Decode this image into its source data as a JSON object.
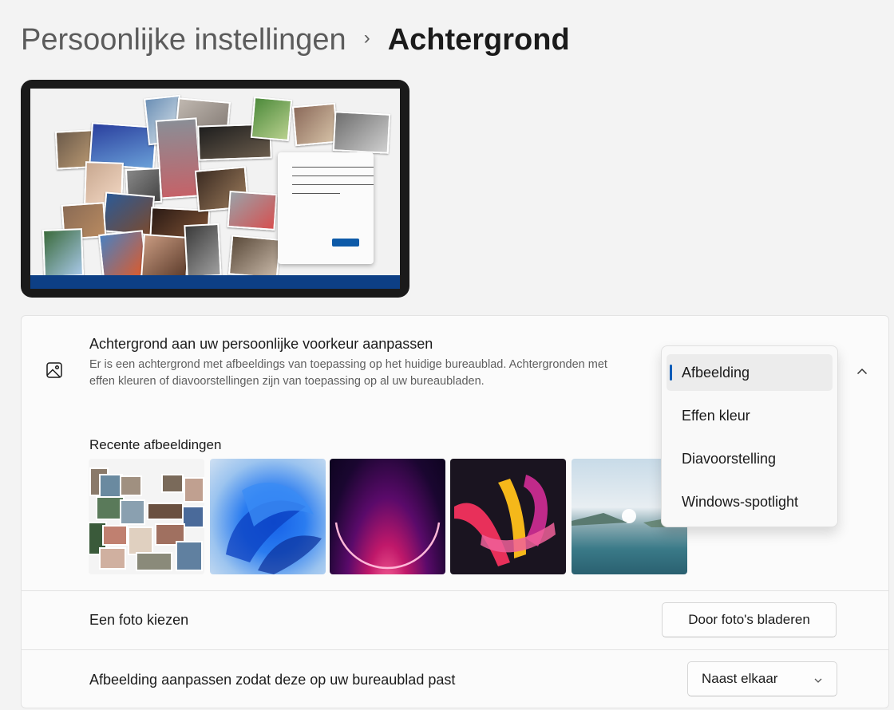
{
  "breadcrumb": {
    "parent": "Persoonlijke instellingen",
    "separator": "›",
    "current": "Achtergrond"
  },
  "background_setting": {
    "icon": "picture-icon",
    "title": "Achtergrond aan uw persoonlijke voorkeur aanpassen",
    "description": "Er is een achtergrond met afbeeldings van toepassing op het huidige bureaublad. Achtergronden met effen kleuren of diavoorstellingen zijn van toepassing op al uw bureaubladen.",
    "selected": "Afbeelding",
    "options": [
      "Afbeelding",
      "Effen kleur",
      "Diavoorstelling",
      "Windows-spotlight"
    ]
  },
  "recent": {
    "title": "Recente afbeeldingen",
    "images": [
      "photo-collage",
      "windows-11-bloom-blue",
      "purple-glow-arc",
      "abstract-colorful-ribbons",
      "lake-landscape"
    ]
  },
  "choose_photo": {
    "label": "Een foto kiezen",
    "button": "Door foto's bladeren"
  },
  "fit": {
    "label": "Afbeelding aanpassen zodat deze op uw bureaublad past",
    "value": "Naast elkaar"
  },
  "colors": {
    "accent": "#0a5cb8",
    "taskbar": "#0d3f85"
  }
}
